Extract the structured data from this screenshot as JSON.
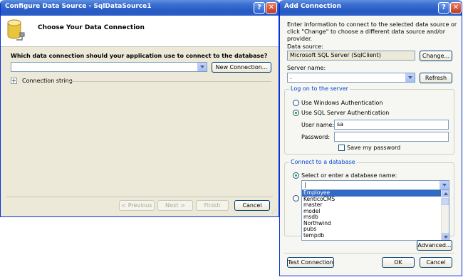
{
  "configure_window": {
    "title": "Configure Data Source - SqlDataSource1",
    "header_title": "Choose Your Data Connection",
    "question": "Which data connection should your application use to connect to the database?",
    "connection_dropdown_value": "",
    "new_connection_label": "New Connection...",
    "connection_string_label": "Connection string",
    "expand_glyph": "+",
    "help_glyph": "?",
    "close_glyph": "✕",
    "previous_label": "< Previous",
    "next_label": "Next >",
    "finish_label": "Finish",
    "cancel_label": "Cancel"
  },
  "add_connection": {
    "title": "Add Connection",
    "help_glyph": "?",
    "close_glyph": "✕",
    "intro": "Enter information to connect to the selected data source or click \"Change\" to choose a different data source and/or provider.",
    "data_source_label": "Data source:",
    "data_source_value": "Microsoft SQL Server (SqlClient)",
    "change_label": "Change...",
    "server_name_label": "Server name:",
    "server_name_value": ".",
    "refresh_label": "Refresh",
    "logon_group_title": "Log on to the server",
    "windows_auth_label": "Use Windows Authentication",
    "sql_auth_label": "Use SQL Server Authentication",
    "user_name_label": "User name:",
    "user_name_value": "sa",
    "password_label": "Password:",
    "password_value": "",
    "save_password_label": "Save my password",
    "connect_group_title": "Connect to a database",
    "select_db_label": "Select or enter a database name:",
    "database_input_value": "|",
    "database_options": [
      "Employee",
      "KenticoCMS",
      "master",
      "model",
      "msdb",
      "Northwind",
      "pubs",
      "tempdb"
    ],
    "selected_database": "Employee",
    "advanced_label": "Advanced...",
    "test_connection_label": "Test Connection",
    "ok_label": "OK",
    "cancel_label": "Cancel"
  },
  "colors": {
    "titlebar": "#2759c3",
    "dialog_body": "#ece9d8",
    "group_title": "#0046d5",
    "selection": "#316ac5"
  },
  "icons": {
    "header_icon": "database-plug-icon",
    "expand_icon": "plus-box-icon"
  }
}
